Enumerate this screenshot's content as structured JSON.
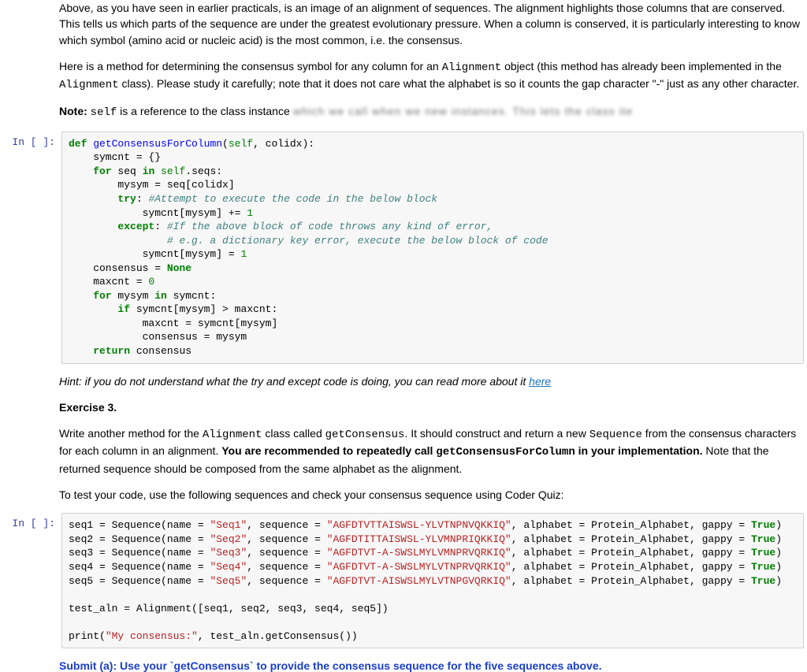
{
  "intro": {
    "p1": "Above, as you have seen in earlier practicals, is an image of an alignment of sequences. The alignment highlights those columns that are conserved. This tells us which parts of the sequence are under the greatest evolutionary pressure. When a column is conserved, it is particularly interesting to know which symbol (amino acid or nucleic acid) is the most common, i.e. the consensus.",
    "p2a": "Here is a method for determining the consensus symbol for any column for an ",
    "p2_code1": "Alignment",
    "p2b": " object (this method has already been implemented in the ",
    "p2_code2": "Alignment",
    "p2c": " class). Please study it carefully; note that it does not care what the alphabet is so it counts the gap character \"-\" just as any other character.",
    "note_label": "Note:",
    "note_code": "self",
    "note_text": " is a reference to the class instance ",
    "note_blur": "which we call when we new instances. This lets the class ite"
  },
  "code1": {
    "line1_def": "def",
    "line1_fn": "getConsensusForColumn",
    "line1_self": "self",
    "line1_rest": ", colidx):",
    "line2": "    symcnt = {}",
    "line3_for": "for",
    "line3_mid": " seq ",
    "line3_in": "in",
    "line3_self": " self",
    "line3_rest": ".seqs:",
    "line4": "        mysym = seq[colidx]",
    "line5_try": "try",
    "line5_colon": ": ",
    "line5_cmt": "#Attempt to execute the code in the below block",
    "line6_a": "            symcnt[mysym] += ",
    "line6_num": "1",
    "line7_except": "except",
    "line7_colon": ": ",
    "line7_cmt": "#If the above block of code throws any kind of error,",
    "line8_cmt": "# e.g. a dictionary key error, execute the below block of code",
    "line9_a": "            symcnt[mysym] = ",
    "line9_num": "1",
    "line10_a": "    consensus = ",
    "line10_none": "None",
    "line11_a": "    maxcnt = ",
    "line11_num": "0",
    "line12_for": "for",
    "line12_mid": " mysym ",
    "line12_in": "in",
    "line12_rest": " symcnt:",
    "line13_if": "if",
    "line13_rest": " symcnt[mysym] > maxcnt:",
    "line14": "            maxcnt = symcnt[mysym]",
    "line15": "            consensus = mysym",
    "line16_return": "return",
    "line16_rest": " consensus"
  },
  "hint": {
    "text": "Hint: if you do not understand what the try and except code is doing, you can read more about it ",
    "link": "here"
  },
  "ex3": {
    "title": "Exercise 3.",
    "p1a": "Write another method for the ",
    "p1_code1": "Alignment",
    "p1b": " class called ",
    "p1_code2": "getConsensus",
    "p1c": ". It should construct and return a new ",
    "p1_code3": "Sequence",
    "p1d": " from the consensus characters for each column in an alignment. ",
    "p1_bold": "You are recommended to repeatedly call ",
    "p1_boldcode": "getConsensusForColumn",
    "p1_bold2": " in your implementation.",
    "p1e": " Note that the returned sequence should be composed from the same alphabet as the alignment.",
    "p2": "To test your code, use the following sequences and check your consensus sequence using Coder Quiz:"
  },
  "code2": {
    "seq_prefix": "seq",
    "seq_assign": " = Sequence(name = ",
    "seq_seqlbl": ", sequence = ",
    "seq_alph": ", alphabet = Protein_Alphabet, gappy = ",
    "seq_true": "True",
    "seq_close": ")",
    "s1_name": "\"Seq1\"",
    "s1_val": "\"AGFDTVTTAISWSL-YLVTNPNVQKKIQ\"",
    "s2_name": "\"Seq2\"",
    "s2_val": "\"AGFDTITTAISWSL-YLVMNPRIQKKIQ\"",
    "s3_name": "\"Seq3\"",
    "s3_val": "\"AGFDTVT-A-SWSLMYLVMNPRVQRKIQ\"",
    "s4_name": "\"Seq4\"",
    "s4_val": "\"AGFDTVT-A-SWSLMYLVTNPRVQRKIQ\"",
    "s5_name": "\"Seq5\"",
    "s5_val": "\"AGFDTVT-AISWSLMYLVTNPGVQRKIQ\"",
    "blank": "",
    "test_aln": "test_aln = Alignment([seq1, seq2, seq3, seq4, seq5])",
    "print_a": "print(",
    "print_str": "\"My consensus:\"",
    "print_b": ", test_aln.getConsensus())"
  },
  "submit": "Submit (a): Use your `getConsensus` to provide the consensus sequence for the five sequences above.",
  "prompt_label": "In [ ]:"
}
